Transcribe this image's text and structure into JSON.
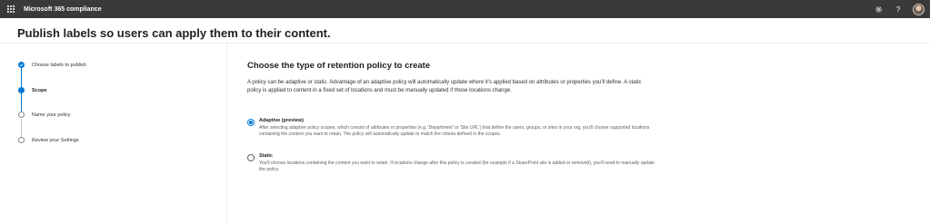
{
  "topbar": {
    "app_title": "Microsoft 365 compliance",
    "waffle_icon": "app-launcher-icon",
    "settings_icon": "gear-icon",
    "help_icon": "help-icon",
    "help_glyph": "?",
    "avatar_icon": "user-avatar"
  },
  "page": {
    "title": "Publish labels so users can apply them to their content."
  },
  "wizard": {
    "steps": [
      {
        "label": "Choose labels to publish",
        "state": "done"
      },
      {
        "label": "Scope",
        "state": "current"
      },
      {
        "label": "Name your policy",
        "state": "todo"
      },
      {
        "label": "Review your Settings",
        "state": "todo"
      }
    ]
  },
  "main": {
    "heading": "Choose the type of retention policy to create",
    "intro": "A policy can be adaptive or static. Advantage of an adaptive policy will automatically update where it's applied based on attributes or properties you'll define. A static policy is applied to content in a fixed set of locations and must be manually updated if those locations change.",
    "options": [
      {
        "label": "Adaptive (preview)",
        "description": "After selecting adaptive policy scopes, which consist of attributes or properties (e.g. 'Department' or 'Site URL') that define the users, groups, or sites in your org, you'll choose supported locations containing the content you want to retain. The policy will automatically update to match the criteria defined in the scopes.",
        "selected": true
      },
      {
        "label": "Static",
        "description": "You'll choose locations containing the content you want to retain. If locations change after this policy is created (for example if a SharePoint site is added or removed), you'll need to manually update the policy.",
        "selected": false
      }
    ]
  },
  "colors": {
    "topbar": "#3b3a39",
    "accent": "#0078d4"
  }
}
